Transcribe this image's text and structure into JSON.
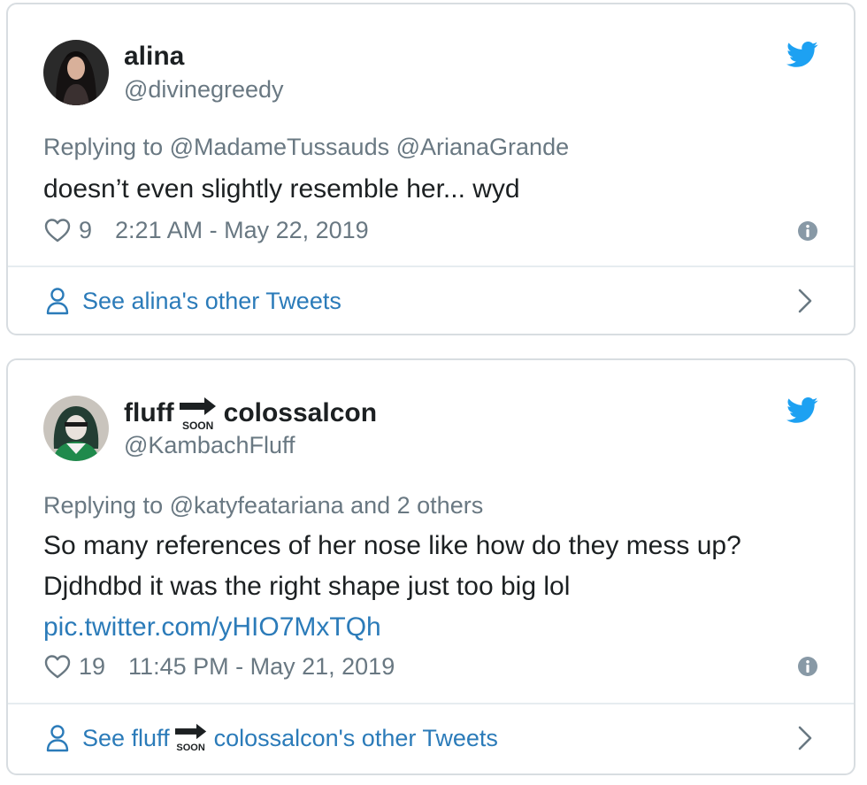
{
  "tweets": [
    {
      "display_name": "alina",
      "handle": "@divinegreedy",
      "replying_to": "Replying to @MadameTussauds @ArianaGrande",
      "text": "doesn’t even slightly resemble her... wyd",
      "likes": "9",
      "timestamp": "2:21 AM - May 22, 2019",
      "footer_link": "See alina's other Tweets",
      "icons": {
        "brand": "twitter-bird-icon",
        "like": "heart-icon",
        "info": "info-icon",
        "profile": "person-icon",
        "more": "chevron-right-icon"
      }
    },
    {
      "display_name_start": "fluff",
      "display_name_emoji": "SOON",
      "display_name_end": "colossalcon",
      "handle": "@KambachFluff",
      "replying_to": "Replying to @katyfeatariana and 2 others",
      "text_line1": "So many references of her nose like how do they mess up?",
      "text_line2": "Djdhdbd it was the right shape just too big lol",
      "link": "pic.twitter.com/yHIO7MxTQh",
      "likes": "19",
      "timestamp": "11:45 PM - May 21, 2019",
      "footer_prefix": "See fluff",
      "footer_suffix": "colossalcon's other Tweets",
      "icons": {
        "brand": "twitter-bird-icon",
        "like": "heart-icon",
        "info": "info-icon",
        "profile": "person-icon",
        "more": "chevron-right-icon",
        "name_emoji": "soon-arrow-icon"
      }
    }
  ],
  "colors": {
    "twitter_blue": "#1da1f2",
    "link_blue": "#2b7bb9",
    "text": "#1c2022",
    "secondary_text": "#697882",
    "border": "#d8dde1"
  }
}
